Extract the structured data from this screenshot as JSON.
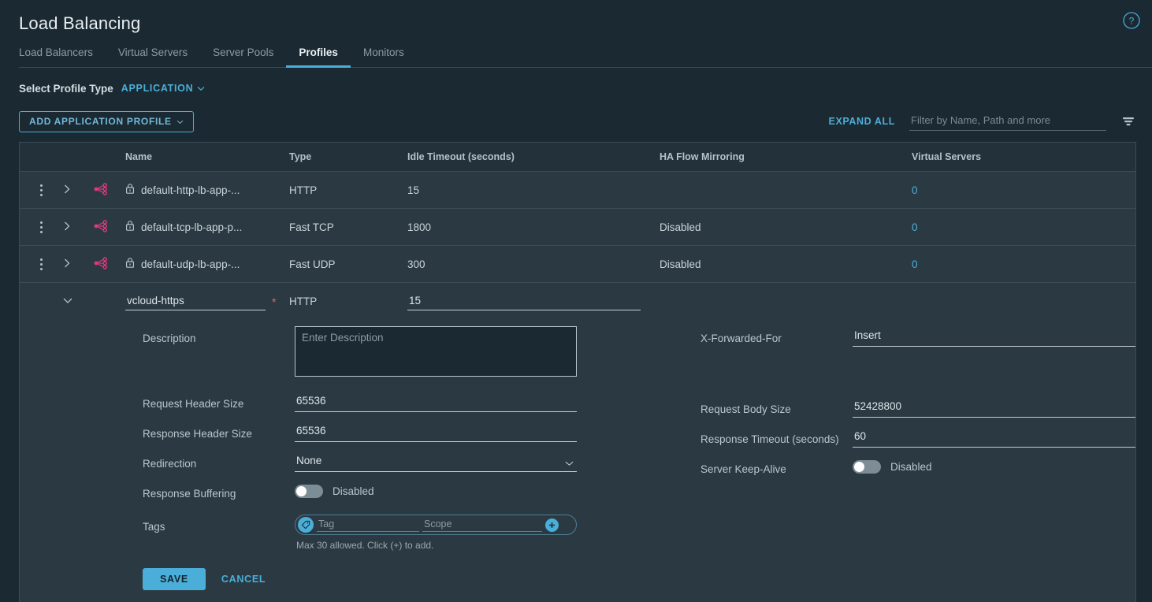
{
  "header": {
    "title": "Load Balancing",
    "help_icon": "help-circle-icon"
  },
  "tabs": [
    {
      "label": "Load Balancers",
      "active": false
    },
    {
      "label": "Virtual Servers",
      "active": false
    },
    {
      "label": "Server Pools",
      "active": false
    },
    {
      "label": "Profiles",
      "active": true
    },
    {
      "label": "Monitors",
      "active": false
    }
  ],
  "profile_type": {
    "label": "Select Profile Type",
    "value": "APPLICATION",
    "chevron_icon": "chevron-down-icon"
  },
  "toolbar": {
    "add_profile_label": "ADD APPLICATION PROFILE",
    "add_profile_chevron": "chevron-down-icon",
    "expand_all_label": "EXPAND ALL",
    "filter_placeholder": "Filter by Name, Path and more",
    "filter_value": "",
    "filter_icon": "filter-funnel-icon"
  },
  "table": {
    "columns": [
      "Name",
      "Type",
      "Idle Timeout (seconds)",
      "HA Flow Mirroring",
      "Virtual Servers"
    ],
    "rows": [
      {
        "actions_icon": "kebab-menu-icon",
        "expand_icon": "chevron-right-icon",
        "topology_icon": "share-topology-icon",
        "lock_icon": "lock-icon",
        "name": "default-http-lb-app-...",
        "type": "HTTP",
        "idle_timeout": "15",
        "ha_flow_mirroring": "",
        "virtual_servers": "0"
      },
      {
        "actions_icon": "kebab-menu-icon",
        "expand_icon": "chevron-right-icon",
        "topology_icon": "share-topology-icon",
        "lock_icon": "lock-icon",
        "name": "default-tcp-lb-app-p...",
        "type": "Fast TCP",
        "idle_timeout": "1800",
        "ha_flow_mirroring": "Disabled",
        "virtual_servers": "0"
      },
      {
        "actions_icon": "kebab-menu-icon",
        "expand_icon": "chevron-right-icon",
        "topology_icon": "share-topology-icon",
        "lock_icon": "lock-icon",
        "name": "default-udp-lb-app-...",
        "type": "Fast UDP",
        "idle_timeout": "300",
        "ha_flow_mirroring": "Disabled",
        "virtual_servers": "0"
      }
    ]
  },
  "editing_row": {
    "collapse_icon": "chevron-down-icon",
    "name_value": "vcloud-https",
    "name_required_marker": "*",
    "type": "HTTP",
    "idle_timeout_value": "15",
    "fields": {
      "description_label": "Description",
      "description_value": "",
      "description_placeholder": "Enter Description",
      "request_header_size_label": "Request Header Size",
      "request_header_size_value": "65536",
      "response_header_size_label": "Response Header Size",
      "response_header_size_value": "65536",
      "redirection_label": "Redirection",
      "redirection_value": "None",
      "response_buffering_label": "Response Buffering",
      "response_buffering_state": "Disabled",
      "tags_label": "Tags",
      "tag_placeholder": "Tag",
      "tag_value": "",
      "scope_placeholder": "Scope",
      "scope_value": "",
      "tags_hint": "Max 30 allowed. Click (+) to add.",
      "tag_icon": "tag-icon",
      "tag_add_icon": "plus-icon",
      "x_forwarded_for_label": "X-Forwarded-For",
      "x_forwarded_for_value": "Insert",
      "request_body_size_label": "Request Body Size",
      "request_body_size_value": "52428800",
      "response_timeout_label": "Response Timeout (seconds)",
      "response_timeout_value": "60",
      "server_keep_alive_label": "Server Keep-Alive",
      "server_keep_alive_state": "Disabled"
    },
    "save_label": "SAVE",
    "cancel_label": "CANCEL"
  },
  "colors": {
    "page_bg": "#1b2a32",
    "row_bg": "#2b3a42",
    "header_strip_bg": "#22313a",
    "accent_blue": "#4aaed9",
    "topology_pink": "#e0397e",
    "required_red": "#e46565",
    "border": "#3b4c55"
  }
}
